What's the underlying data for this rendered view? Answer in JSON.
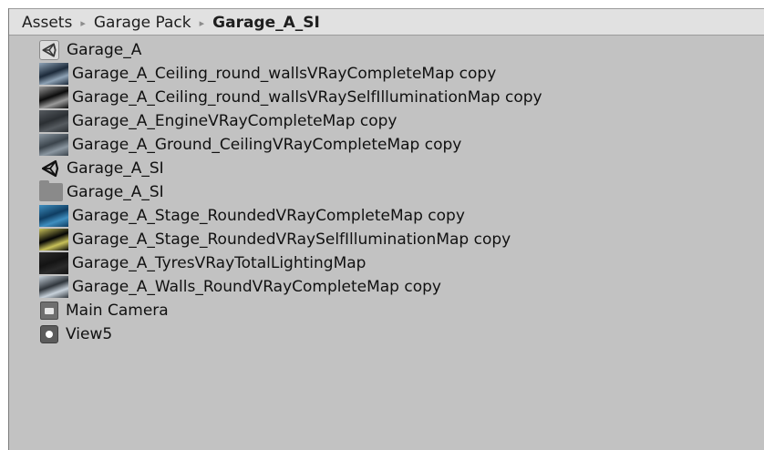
{
  "breadcrumb": {
    "items": [
      "Assets",
      "Garage Pack",
      "Garage_A_SI"
    ],
    "separator": "▸"
  },
  "assets": [
    {
      "name": "Garage_A",
      "icon": "unity-scene-icon"
    },
    {
      "name": "Garage_A_Ceiling_round_wallsVRayCompleteMap copy",
      "icon": "texture-icon",
      "colors": [
        "#1c2a3a",
        "#8fa3b6"
      ]
    },
    {
      "name": "Garage_A_Ceiling_round_wallsVRaySelfIlluminationMap copy",
      "icon": "texture-icon",
      "colors": [
        "#0c0c0c",
        "#9a9a9a"
      ]
    },
    {
      "name": "Garage_A_EngineVRayCompleteMap copy",
      "icon": "texture-icon",
      "colors": [
        "#2b2f33",
        "#565b60"
      ]
    },
    {
      "name": "Garage_A_Ground_CeilingVRayCompleteMap copy",
      "icon": "texture-icon",
      "colors": [
        "#3b444c",
        "#8b97a1"
      ]
    },
    {
      "name": "Garage_A_SI",
      "icon": "unity-prefab-icon"
    },
    {
      "name": "Garage_A_SI",
      "icon": "folder-icon"
    },
    {
      "name": "Garage_A_Stage_RoundedVRayCompleteMap copy",
      "icon": "texture-icon",
      "colors": [
        "#0f3d62",
        "#3f8fc0"
      ]
    },
    {
      "name": "Garage_A_Stage_RoundedVRaySelfIlluminationMap copy",
      "icon": "texture-icon",
      "colors": [
        "#050505",
        "#c9c25a"
      ]
    },
    {
      "name": "Garage_A_TyresVRayTotalLightingMap",
      "icon": "texture-icon",
      "colors": [
        "#141414",
        "#2a2a2a"
      ]
    },
    {
      "name": "Garage_A_Walls_RoundVRayCompleteMap copy",
      "icon": "texture-icon",
      "colors": [
        "#30363c",
        "#c8d2db"
      ]
    },
    {
      "name": "Main Camera",
      "icon": "camera-icon"
    },
    {
      "name": "View5",
      "icon": "view-icon"
    }
  ]
}
